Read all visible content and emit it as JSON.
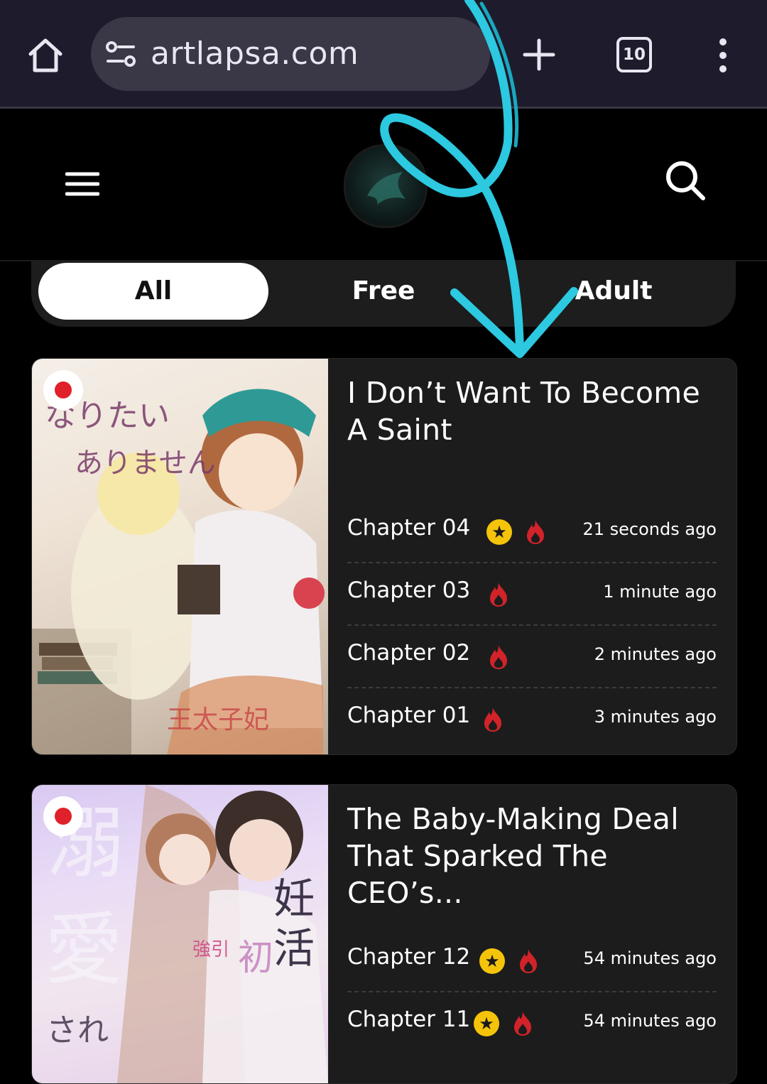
{
  "browser": {
    "url": "artlapsa.com",
    "tab_count": "10"
  },
  "filters": [
    {
      "label": "All",
      "active": true
    },
    {
      "label": "Free",
      "active": false
    },
    {
      "label": "Adult",
      "active": false
    }
  ],
  "series": [
    {
      "title": "I Don’t Want To Become A Saint",
      "chapters": [
        {
          "name": "Chapter 04",
          "premium": true,
          "hot": true,
          "time": "21 seconds ago"
        },
        {
          "name": "Chapter 03",
          "premium": false,
          "hot": true,
          "time": "1 minute ago"
        },
        {
          "name": "Chapter 02",
          "premium": false,
          "hot": true,
          "time": "2 minutes ago"
        },
        {
          "name": "Chapter 01",
          "premium": false,
          "hot": true,
          "time": "3 minutes ago"
        }
      ]
    },
    {
      "title": "The Baby-Making Deal That Sparked The CEO’s...",
      "chapters": [
        {
          "name": "Chapter 12",
          "premium": true,
          "hot": true,
          "time": "54 minutes ago"
        },
        {
          "name": "Chapter 11",
          "premium": true,
          "hot": true,
          "time": "54 minutes ago"
        }
      ]
    }
  ],
  "icons": {
    "home": "home-icon",
    "site_info": "site-info-icon",
    "new_tab": "plus-icon",
    "tabs": "tab-switcher-icon",
    "menu": "more-vert-icon",
    "hamburger": "hamburger-menu-icon",
    "search": "search-icon",
    "star": "star-icon",
    "fire": "fire-icon"
  },
  "colors": {
    "browser_bar": "#1e1c2c",
    "url_pill": "#3a3846",
    "page_background": "#000000",
    "card_background": "#1c1c1c",
    "star_badge": "#f5c40a",
    "fire_badge": "#d2232a",
    "cover_dot": "#e0202a"
  }
}
